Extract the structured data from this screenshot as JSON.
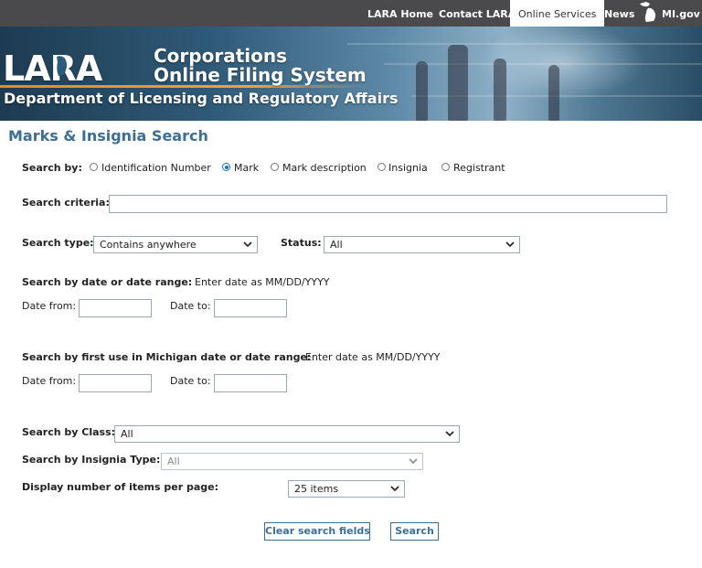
{
  "nav": {
    "items": [
      "LARA Home",
      "Contact LARA",
      "Online Services",
      "News"
    ],
    "active": "Online Services",
    "mi_label": "MI.gov"
  },
  "banner": {
    "logo": "LARA",
    "title_line1": "Corporations",
    "title_line2": "Online Filing System",
    "subtitle": "Department of Licensing and Regulatory Affairs"
  },
  "page": {
    "title": "Marks & Insignia Search"
  },
  "search_by": {
    "label": "Search by:",
    "options": [
      "Identification Number",
      "Mark",
      "Mark description",
      "Insignia",
      "Registrant"
    ],
    "selected": "Mark"
  },
  "criteria": {
    "label": "Search criteria:",
    "value": ""
  },
  "search_type": {
    "label": "Search type:",
    "value": "Contains anywhere"
  },
  "status": {
    "label": "Status:",
    "value": "All"
  },
  "date_range": {
    "label": "Search by date or date range:",
    "hint": "Enter date as MM/DD/YYYY",
    "from_label": "Date from:",
    "to_label": "Date to:",
    "from_value": "",
    "to_value": ""
  },
  "first_use": {
    "label": "Search by first use in Michigan date or date range:",
    "hint": "Enter date as MM/DD/YYYY",
    "from_label": "Date from:",
    "to_label": "Date to:",
    "from_value": "",
    "to_value": ""
  },
  "class": {
    "label": "Search by Class:",
    "value": "All"
  },
  "insignia_type": {
    "label": "Search by Insignia Type:",
    "value": "All"
  },
  "per_page": {
    "label": "Display number of items per page:",
    "value": "25 items"
  },
  "buttons": {
    "clear": "Clear search fields",
    "search": "Search"
  },
  "colors": {
    "nav_bg": "#4a4a4d",
    "title_blue": "#3d6f95",
    "radio_blue": "#1a6fd1",
    "accent_orange": "#e08a2a"
  }
}
